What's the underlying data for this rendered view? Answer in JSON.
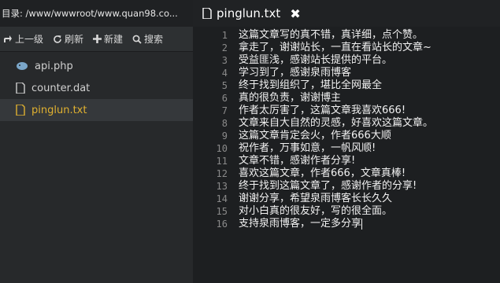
{
  "sidebar": {
    "path_label": "目录:",
    "path_value": "/www/wwwroot/www.quan98.co...",
    "toolbar": {
      "up": "上一级",
      "refresh": "刷新",
      "new": "新建",
      "search": "搜索"
    },
    "files": [
      {
        "name": "api.php",
        "icon": "elephant-php-icon"
      },
      {
        "name": "counter.dat",
        "icon": "file-icon"
      },
      {
        "name": "pinglun.txt",
        "icon": "file-icon",
        "active": true
      }
    ]
  },
  "editor": {
    "tab_title": "pinglun.txt",
    "tab_close": "✖",
    "collapse_glyph": "‹",
    "lines": [
      {
        "no": "1",
        "text": "这篇文章写的真不错，真详细，点个赞。"
      },
      {
        "no": "2",
        "text": "拿走了，谢谢站长，一直在看站长的文章~"
      },
      {
        "no": "3",
        "text": "受益匪浅，感谢站长提供的平台。"
      },
      {
        "no": "4",
        "text": "学习到了，感谢泉雨博客"
      },
      {
        "no": "5",
        "text": "终于找到组织了，堪比全网最全"
      },
      {
        "no": "6",
        "text": "真的很负责，谢谢博主"
      },
      {
        "no": "7",
        "text": "作者太厉害了，这篇文章我喜欢666!"
      },
      {
        "no": "8",
        "text": "文章来自大自然的灵感，好喜欢这篇文章。"
      },
      {
        "no": "9",
        "text": "这篇文章肯定会火，作者666大顺"
      },
      {
        "no": "10",
        "text": "祝作者，万事如意，一帆风顺!"
      },
      {
        "no": "11",
        "text": "文章不错，感谢作者分享!"
      },
      {
        "no": "12",
        "text": "喜欢这篇文章，作者666，文章真棒!"
      },
      {
        "no": "13",
        "text": "终于找到这篇文章了，感谢作者的分享!"
      },
      {
        "no": "14",
        "text": "谢谢分享，希望泉雨博客长长久久"
      },
      {
        "no": "15",
        "text": "对小白真的很友好，写的很全面。"
      },
      {
        "no": "16",
        "text": "支持泉雨博客，一定多分享"
      }
    ]
  },
  "colors": {
    "active_file": "#e0b130",
    "editor_bg": "#1d1f21",
    "sidebar_bg": "#27292b"
  }
}
